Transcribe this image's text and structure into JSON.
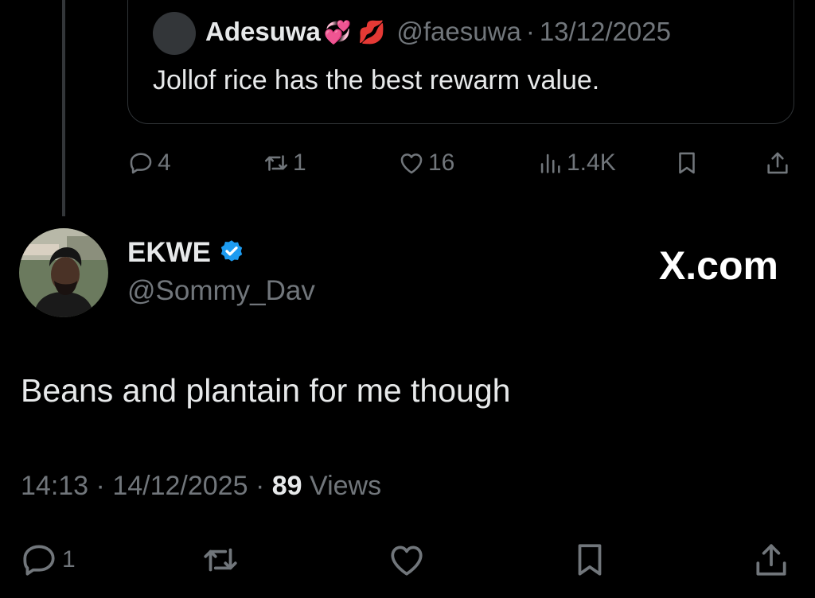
{
  "quoted_tweet": {
    "author_name": "Adesuwa",
    "emojis": "💞 💋",
    "handle": "@faesuwa",
    "separator": "·",
    "date": "13/12/2025",
    "text": "Jollof rice has the best rewarm value."
  },
  "parent_actions": {
    "replies": "4",
    "reposts": "1",
    "likes": "16",
    "views": "1.4K"
  },
  "tweet": {
    "author_name": "EKWE",
    "handle": "@Sommy_Dav",
    "text": "Beans and plantain for me though",
    "time": "14:13",
    "sep1": "·",
    "date": "14/12/2025",
    "sep2": "·",
    "views_count": "89",
    "views_label": "Views"
  },
  "tweet_actions": {
    "replies": "1"
  },
  "watermark": "X.com",
  "colors": {
    "background": "#000000",
    "text": "#e7e9ea",
    "muted": "#71767b",
    "verified": "#1d9bf0"
  }
}
